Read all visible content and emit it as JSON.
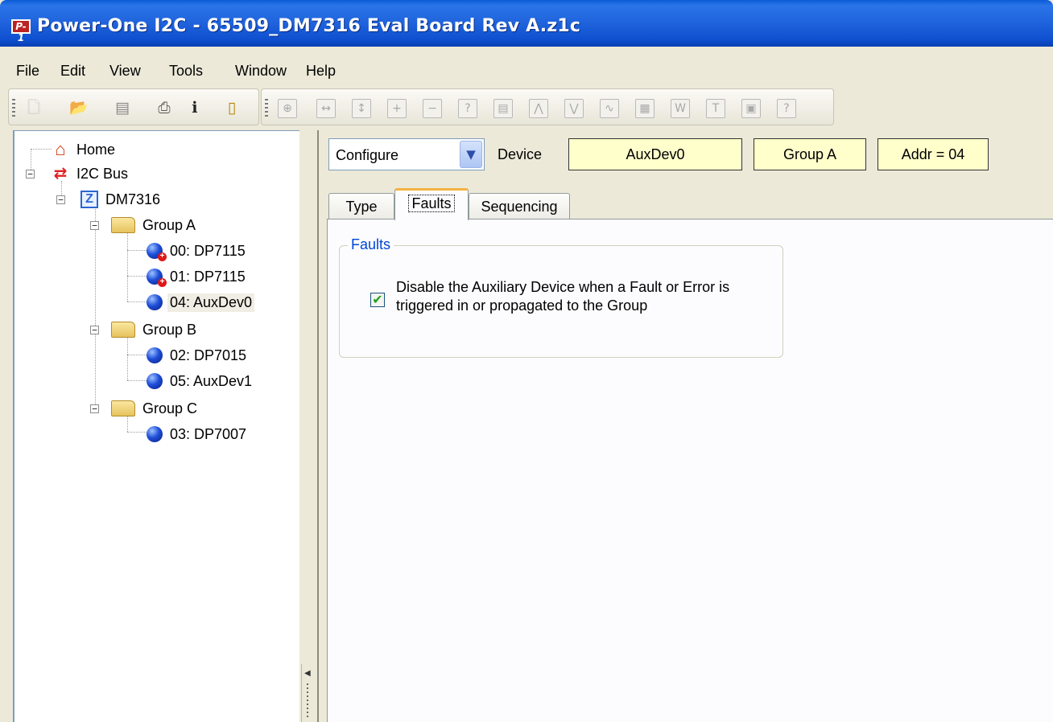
{
  "window": {
    "title": "Power-One I2C - 65509_DM7316 Eval Board Rev A.z1c",
    "app_icon_text": "P-1"
  },
  "menu": [
    "File",
    "Edit",
    "View",
    "Tools",
    "Window",
    "Help"
  ],
  "toolbar": {
    "file_icons": [
      "new-file-icon",
      "open-folder-icon",
      "save-icon",
      "print-icon",
      "info-icon",
      "exit-door-icon"
    ],
    "tool_glyphs": [
      "⊕",
      "↔",
      "↕",
      "+",
      "−",
      "?",
      "▤",
      "⋀",
      "⋁",
      "∿",
      "▦",
      "W",
      "T",
      "▣",
      "?"
    ]
  },
  "tree": {
    "home": "Home",
    "bus": "I2C Bus",
    "board": "DM7316",
    "group_a": "Group A",
    "dev_00": "00: DP7115",
    "dev_01": "01: DP7115",
    "dev_04": "04: AuxDev0",
    "group_b": "Group B",
    "dev_02": "02: DP7015",
    "dev_05": "05: AuxDev1",
    "group_c": "Group C",
    "dev_03": "03: DP7007"
  },
  "main": {
    "mode_select": "Configure",
    "device_label": "Device",
    "device_name": "AuxDev0",
    "device_group": "Group A",
    "device_addr": "Addr = 04",
    "tabs": [
      "Type",
      "Faults",
      "Sequencing"
    ],
    "active_tab": "Faults",
    "faults_group_title": "Faults",
    "disable_checkbox_label": "Disable the Auxiliary Device when a Fault or Error is triggered in or propagated to the Group",
    "disable_checked": true
  }
}
